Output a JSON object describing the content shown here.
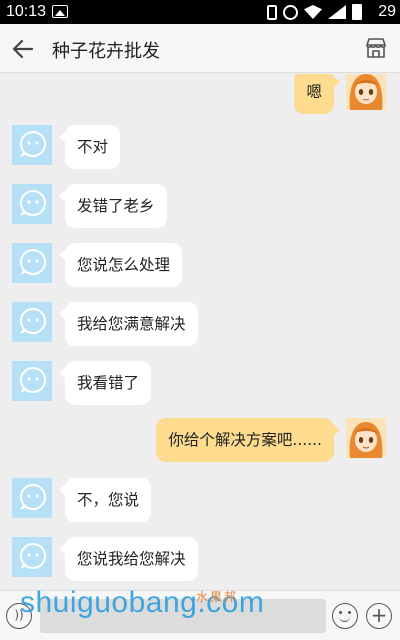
{
  "status_bar": {
    "time": "10:13",
    "battery_level": "29"
  },
  "app_bar": {
    "title": "种子花卉批发",
    "back_icon": "arrow-left-icon",
    "store_icon": "store-icon"
  },
  "messages": [
    {
      "side": "right",
      "text": "嗯"
    },
    {
      "side": "left",
      "text": "不对"
    },
    {
      "side": "left",
      "text": "发错了老乡"
    },
    {
      "side": "left",
      "text": "您说怎么处理"
    },
    {
      "side": "left",
      "text": "我给您满意解决"
    },
    {
      "side": "left",
      "text": "我看错了"
    },
    {
      "side": "right",
      "text": "你给个解决方案吧......"
    },
    {
      "side": "left",
      "text": "不，您说"
    },
    {
      "side": "left",
      "text": "您说我给您解决"
    }
  ],
  "input_bar": {
    "voice_icon": "voice-icon",
    "input_value": "",
    "emoji_icon": "emoji-icon",
    "plus_icon": "plus-icon"
  },
  "watermark": {
    "text": "shuiguobang.com",
    "sub": "水果邦"
  },
  "colors": {
    "bubble_right": "#fddb8f",
    "bubble_left": "#ffffff",
    "avatar_bot": "#b5e0f5",
    "background": "#eeeeee"
  }
}
